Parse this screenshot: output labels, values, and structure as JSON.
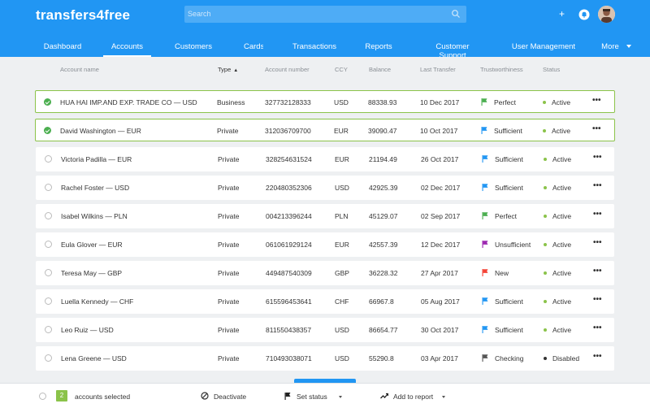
{
  "app": {
    "logo": "transfers4free"
  },
  "search": {
    "placeholder": "Search"
  },
  "nav": {
    "items": [
      {
        "label": "Dashboard"
      },
      {
        "label": "Accounts",
        "active": true
      },
      {
        "label": "Customers"
      },
      {
        "label": "Cards"
      },
      {
        "label": "Transactions"
      },
      {
        "label": "Reports"
      },
      {
        "label": "Customer Support"
      },
      {
        "label": "User Management"
      },
      {
        "label": "More"
      }
    ]
  },
  "table": {
    "headers": {
      "name": "Account name",
      "type": "Type",
      "number": "Account number",
      "ccy": "CCY",
      "balance": "Balance",
      "last": "Last Transfer",
      "trust": "Trustworthiness",
      "status": "Status"
    },
    "rows": [
      {
        "selected": true,
        "name": "HUA HAI IMP.AND EXP. TRADE CO — USD",
        "type": "Business",
        "number": "327732128333",
        "ccy": "USD",
        "balance": "88338.93",
        "last": "10 Dec 2017",
        "trust": "Perfect",
        "trust_color": "#4caf50",
        "status": "Active",
        "status_color": "#8bc34a"
      },
      {
        "selected": true,
        "name": "David Washington — EUR",
        "type": "Private",
        "number": "312036709700",
        "ccy": "EUR",
        "balance": "39090.47",
        "last": "10 Oct 2017",
        "trust": "Sufficient",
        "trust_color": "#2196f3",
        "status": "Active",
        "status_color": "#8bc34a"
      },
      {
        "selected": false,
        "name": "Victoria Padilla — EUR",
        "type": "Private",
        "number": "328254631524",
        "ccy": "EUR",
        "balance": "21194.49",
        "last": "26 Oct 2017",
        "trust": "Sufficient",
        "trust_color": "#2196f3",
        "status": "Active",
        "status_color": "#8bc34a"
      },
      {
        "selected": false,
        "name": "Rachel Foster — USD",
        "type": "Private",
        "number": "220480352306",
        "ccy": "USD",
        "balance": "42925.39",
        "last": "02 Dec 2017",
        "trust": "Sufficient",
        "trust_color": "#2196f3",
        "status": "Active",
        "status_color": "#8bc34a"
      },
      {
        "selected": false,
        "name": "Isabel Wilkins — PLN",
        "type": "Private",
        "number": "004213396244",
        "ccy": "PLN",
        "balance": "45129.07",
        "last": "02 Sep 2017",
        "trust": "Perfect",
        "trust_color": "#4caf50",
        "status": "Active",
        "status_color": "#8bc34a"
      },
      {
        "selected": false,
        "name": "Eula Glover — EUR",
        "type": "Private",
        "number": "061061929124",
        "ccy": "EUR",
        "balance": "42557.39",
        "last": "12 Dec 2017",
        "trust": "Unsufficient",
        "trust_color": "#9c27b0",
        "status": "Active",
        "status_color": "#8bc34a"
      },
      {
        "selected": false,
        "name": "Teresa May — GBP",
        "type": "Private",
        "number": "449487540309",
        "ccy": "GBP",
        "balance": "36228.32",
        "last": "27 Apr 2017",
        "trust": "New",
        "trust_color": "#f44336",
        "status": "Active",
        "status_color": "#8bc34a"
      },
      {
        "selected": false,
        "name": "Luella Kennedy — CHF",
        "type": "Private",
        "number": "615596453641",
        "ccy": "CHF",
        "balance": "66967.8",
        "last": "05 Aug 2017",
        "trust": "Sufficient",
        "trust_color": "#2196f3",
        "status": "Active",
        "status_color": "#8bc34a"
      },
      {
        "selected": false,
        "name": "Leo Ruiz — USD",
        "type": "Private",
        "number": "811550438357",
        "ccy": "USD",
        "balance": "86654.77",
        "last": "30 Oct 2017",
        "trust": "Sufficient",
        "trust_color": "#2196f3",
        "status": "Active",
        "status_color": "#8bc34a"
      },
      {
        "selected": false,
        "name": "Lena Greene — USD",
        "type": "Private",
        "number": "710493038071",
        "ccy": "USD",
        "balance": "55290.8",
        "last": "03 Apr 2017",
        "trust": "Checking",
        "trust_color": "#555555",
        "status": "Disabled",
        "status_color": "#333333"
      }
    ],
    "row_menu": "•••"
  },
  "bottom": {
    "selected_count": "2",
    "selected_label": "accounts selected",
    "deactivate": "Deactivate",
    "set_status": "Set status",
    "add_report": "Add to report"
  },
  "colors": {
    "brand": "#2196f3",
    "selected_border": "#8bc34a"
  }
}
